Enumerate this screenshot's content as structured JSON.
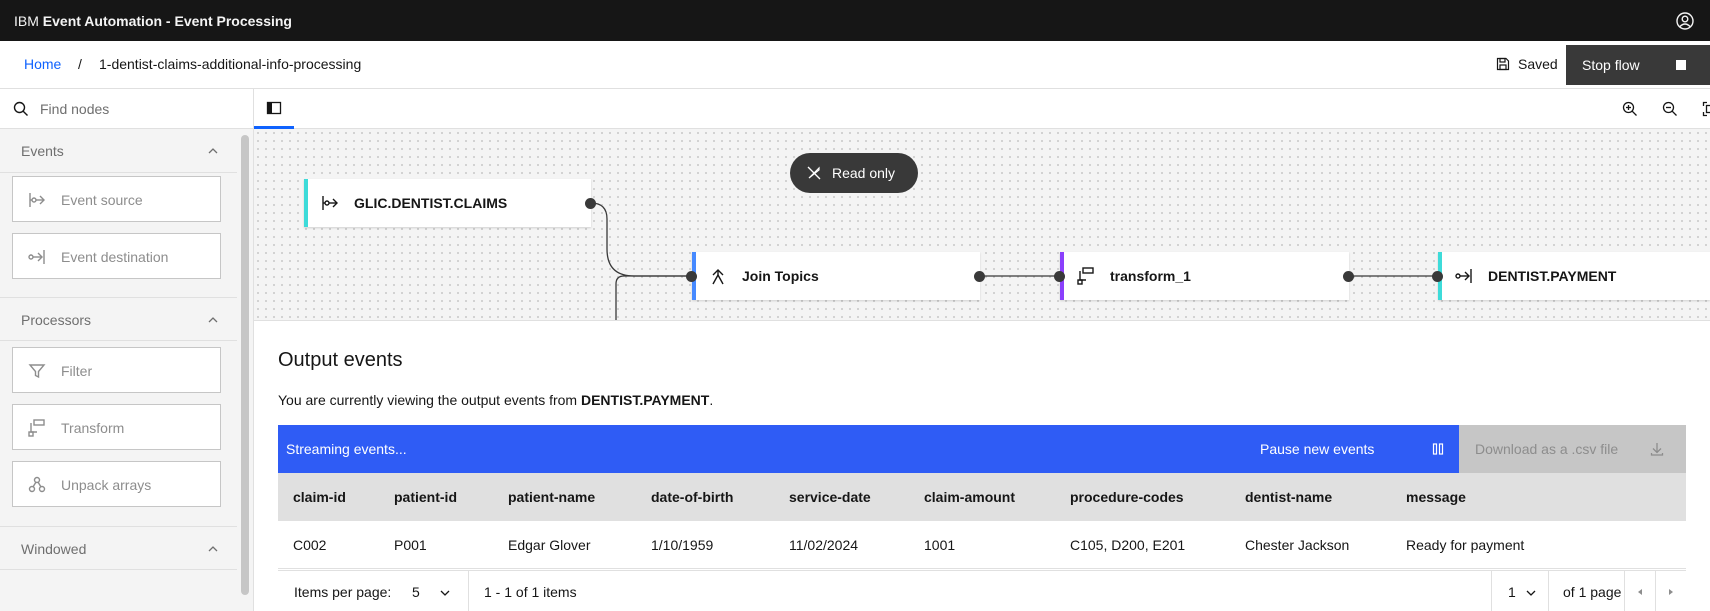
{
  "app": {
    "brand_prefix": "IBM",
    "brand_name": "Event Automation - Event Processing",
    "user_icon": "user-avatar-icon"
  },
  "breadcrumb": {
    "home": "Home",
    "separator": "/",
    "current": "1-dentist-claims-additional-info-processing"
  },
  "flow_status": {
    "saved_label": "Saved",
    "stop_label": "Stop flow"
  },
  "palette": {
    "search_placeholder": "Find nodes",
    "sections": [
      {
        "title": "Events",
        "items": [
          {
            "label": "Event source",
            "icon": "event-source-icon"
          },
          {
            "label": "Event destination",
            "icon": "event-destination-icon"
          }
        ]
      },
      {
        "title": "Processors",
        "items": [
          {
            "label": "Filter",
            "icon": "filter-icon"
          },
          {
            "label": "Transform",
            "icon": "transform-icon"
          },
          {
            "label": "Unpack arrays",
            "icon": "unpack-arrays-icon"
          }
        ]
      },
      {
        "title": "Windowed",
        "items": []
      }
    ]
  },
  "canvas": {
    "read_only_label": "Read only",
    "nodes": [
      {
        "label": "GLIC.DENTIST.CLAIMS",
        "type": "event-source",
        "color": "#3ddbd9"
      },
      {
        "label": "Join Topics",
        "type": "join",
        "color": "#4589ff"
      },
      {
        "label": "transform_1",
        "type": "transform",
        "color": "#8a3ffc"
      },
      {
        "label": "DENTIST.PAYMENT",
        "type": "event-destination",
        "color": "#3ddbd9"
      }
    ]
  },
  "output": {
    "title": "Output events",
    "description_prefix": "You are currently viewing the output events from ",
    "description_target": "DENTIST.PAYMENT",
    "description_suffix": ".",
    "streaming_label": "Streaming events...",
    "pause_label": "Pause new events",
    "download_label": "Download as a .csv file",
    "columns": [
      "claim-id",
      "patient-id",
      "patient-name",
      "date-of-birth",
      "service-date",
      "claim-amount",
      "procedure-codes",
      "dentist-name",
      "message"
    ],
    "rows": [
      [
        "C002",
        "P001",
        "Edgar Glover",
        "1/10/1959",
        "11/02/2024",
        "1001",
        "C105, D200, E201",
        "Chester Jackson",
        "Ready for payment"
      ]
    ],
    "pagination": {
      "items_per_page_label": "Items per page:",
      "items_per_page": "5",
      "range": "1 - 1 of 1 items",
      "page": "1",
      "of_pages": "of 1 page"
    }
  },
  "colors": {
    "header_bg": "#161616",
    "link": "#0f62fe",
    "streaming_bar": "#2f5cf5",
    "stop_button": "#393939"
  }
}
